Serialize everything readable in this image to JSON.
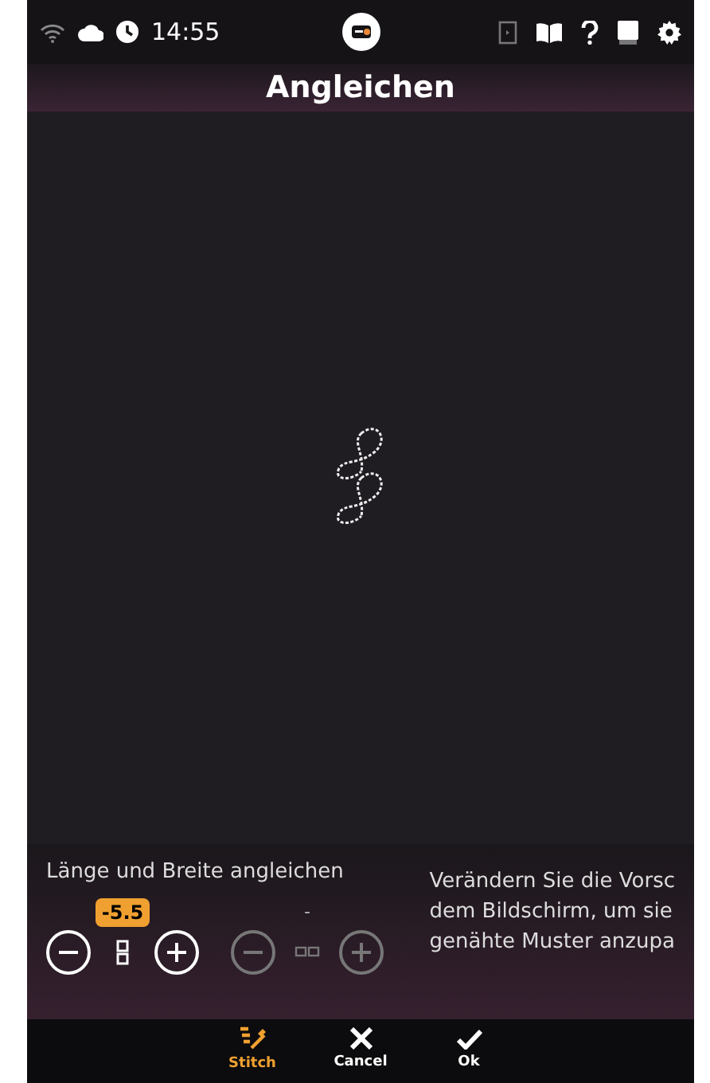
{
  "status_bar": {
    "time": "14:55"
  },
  "title": "Angleichen",
  "adjust": {
    "label": "Länge und Breite angleichen",
    "controls": [
      {
        "kind": "length",
        "value": "-5.5",
        "disabled": false
      },
      {
        "kind": "width",
        "value": "-",
        "disabled": true
      }
    ]
  },
  "description": [
    "Verändern Sie die Vorsc",
    "dem Bildschirm, um sie",
    "genähte Muster anzupa"
  ],
  "toolbar": [
    {
      "label": "Stitch",
      "kind": "stitch",
      "selected": true
    },
    {
      "label": "Cancel",
      "kind": "cancel",
      "selected": false
    },
    {
      "label": "Ok",
      "kind": "ok",
      "selected": false
    }
  ]
}
